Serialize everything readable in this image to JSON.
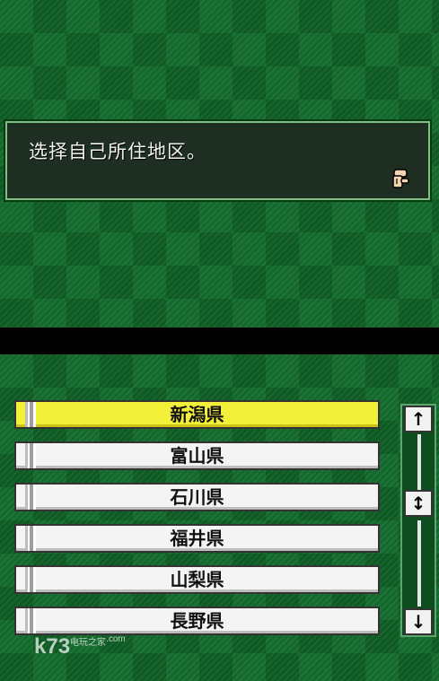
{
  "dialog": {
    "message": "选择自己所住地区。"
  },
  "list": {
    "items": [
      {
        "label": "新潟県",
        "selected": true
      },
      {
        "label": "富山県",
        "selected": false
      },
      {
        "label": "石川県",
        "selected": false
      },
      {
        "label": "福井県",
        "selected": false
      },
      {
        "label": "山梨県",
        "selected": false
      },
      {
        "label": "長野県",
        "selected": false
      }
    ]
  },
  "scrollbar": {
    "up_glyph": "↑",
    "thumb_glyph": "↕",
    "down_glyph": "↓"
  },
  "watermark": {
    "text": "k73",
    "sub": "电玩之家",
    "domain": ".com"
  },
  "colors": {
    "background": "#13692c",
    "selected_item": "#f3f03a",
    "item": "#f4f4f4"
  }
}
